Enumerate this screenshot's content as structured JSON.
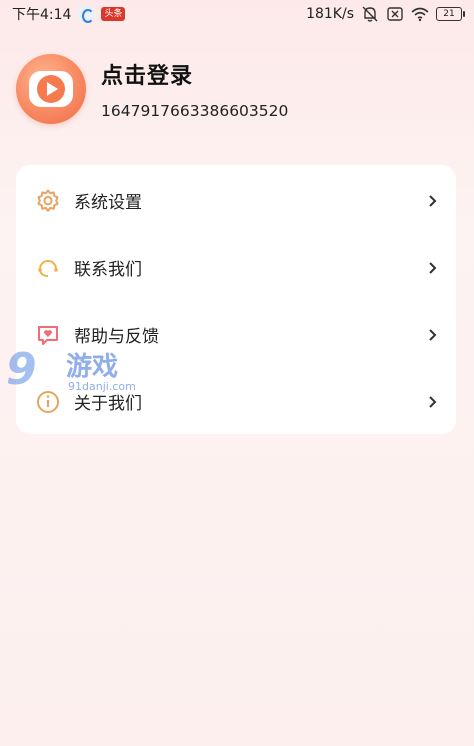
{
  "status_bar": {
    "time": "下午4:14",
    "news_badge": "头条",
    "net_speed": "181K/s",
    "battery": "21"
  },
  "profile": {
    "login_label": "点击登录",
    "user_id": "1647917663386603520"
  },
  "menu": {
    "items": [
      {
        "label": "系统设置",
        "icon": "gear-icon"
      },
      {
        "label": "联系我们",
        "icon": "headset-icon"
      },
      {
        "label": "帮助与反馈",
        "icon": "feedback-heart-icon"
      },
      {
        "label": "关于我们",
        "icon": "info-icon"
      }
    ]
  },
  "watermark": {
    "number": "9",
    "text": "游戏",
    "url": "91danji.com"
  },
  "colors": {
    "accent_orange": "#f57b4f",
    "background": "#fdf1f0",
    "card": "#ffffff"
  }
}
